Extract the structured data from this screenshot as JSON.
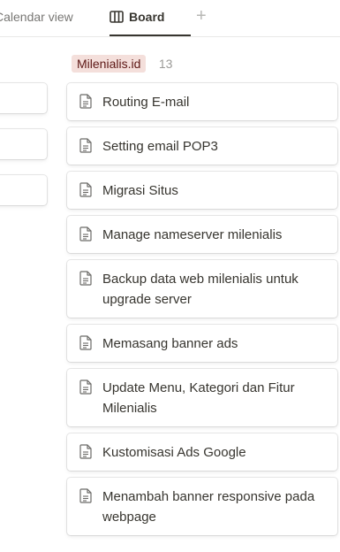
{
  "tabs": {
    "calendar_label": "Calendar view",
    "board_label": "Board",
    "add_symbol": "+"
  },
  "group": {
    "name": "Milenialis.id",
    "count": "13",
    "pill_bg": "#f4dfdb",
    "pill_text": "#5d1715"
  },
  "cards": [
    {
      "title": "Routing E-mail"
    },
    {
      "title": "Setting email POP3"
    },
    {
      "title": "Migrasi Situs"
    },
    {
      "title": "Manage nameserver milenialis"
    },
    {
      "title": "Backup data web milenialis untuk upgrade server"
    },
    {
      "title": "Memasang banner ads"
    },
    {
      "title": "Update Menu, Kategori dan Fitur Milenialis"
    },
    {
      "title": "Kustomisasi Ads Google"
    },
    {
      "title": "Menambah banner responsive pada webpage"
    }
  ],
  "icons": {
    "tab_board": "board-icon",
    "card": "page-icon",
    "add": "plus-icon"
  }
}
